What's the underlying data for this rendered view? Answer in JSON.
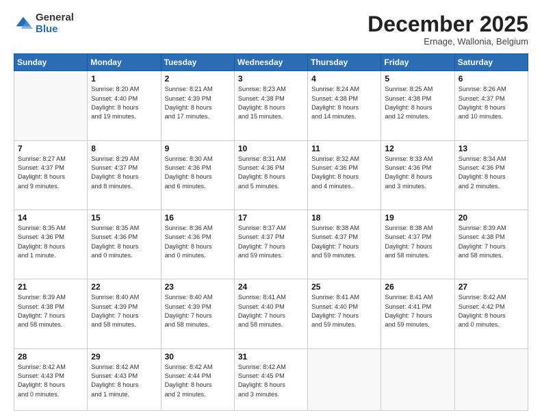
{
  "logo": {
    "general": "General",
    "blue": "Blue"
  },
  "header": {
    "month": "December 2025",
    "location": "Ernage, Wallonia, Belgium"
  },
  "weekdays": [
    "Sunday",
    "Monday",
    "Tuesday",
    "Wednesday",
    "Thursday",
    "Friday",
    "Saturday"
  ],
  "weeks": [
    [
      {
        "day": "",
        "info": ""
      },
      {
        "day": "1",
        "info": "Sunrise: 8:20 AM\nSunset: 4:40 PM\nDaylight: 8 hours\nand 19 minutes."
      },
      {
        "day": "2",
        "info": "Sunrise: 8:21 AM\nSunset: 4:39 PM\nDaylight: 8 hours\nand 17 minutes."
      },
      {
        "day": "3",
        "info": "Sunrise: 8:23 AM\nSunset: 4:38 PM\nDaylight: 8 hours\nand 15 minutes."
      },
      {
        "day": "4",
        "info": "Sunrise: 8:24 AM\nSunset: 4:38 PM\nDaylight: 8 hours\nand 14 minutes."
      },
      {
        "day": "5",
        "info": "Sunrise: 8:25 AM\nSunset: 4:38 PM\nDaylight: 8 hours\nand 12 minutes."
      },
      {
        "day": "6",
        "info": "Sunrise: 8:26 AM\nSunset: 4:37 PM\nDaylight: 8 hours\nand 10 minutes."
      }
    ],
    [
      {
        "day": "7",
        "info": "Sunrise: 8:27 AM\nSunset: 4:37 PM\nDaylight: 8 hours\nand 9 minutes."
      },
      {
        "day": "8",
        "info": "Sunrise: 8:29 AM\nSunset: 4:37 PM\nDaylight: 8 hours\nand 8 minutes."
      },
      {
        "day": "9",
        "info": "Sunrise: 8:30 AM\nSunset: 4:36 PM\nDaylight: 8 hours\nand 6 minutes."
      },
      {
        "day": "10",
        "info": "Sunrise: 8:31 AM\nSunset: 4:36 PM\nDaylight: 8 hours\nand 5 minutes."
      },
      {
        "day": "11",
        "info": "Sunrise: 8:32 AM\nSunset: 4:36 PM\nDaylight: 8 hours\nand 4 minutes."
      },
      {
        "day": "12",
        "info": "Sunrise: 8:33 AM\nSunset: 4:36 PM\nDaylight: 8 hours\nand 3 minutes."
      },
      {
        "day": "13",
        "info": "Sunrise: 8:34 AM\nSunset: 4:36 PM\nDaylight: 8 hours\nand 2 minutes."
      }
    ],
    [
      {
        "day": "14",
        "info": "Sunrise: 8:35 AM\nSunset: 4:36 PM\nDaylight: 8 hours\nand 1 minute."
      },
      {
        "day": "15",
        "info": "Sunrise: 8:35 AM\nSunset: 4:36 PM\nDaylight: 8 hours\nand 0 minutes."
      },
      {
        "day": "16",
        "info": "Sunrise: 8:36 AM\nSunset: 4:36 PM\nDaylight: 8 hours\nand 0 minutes."
      },
      {
        "day": "17",
        "info": "Sunrise: 8:37 AM\nSunset: 4:37 PM\nDaylight: 7 hours\nand 59 minutes."
      },
      {
        "day": "18",
        "info": "Sunrise: 8:38 AM\nSunset: 4:37 PM\nDaylight: 7 hours\nand 59 minutes."
      },
      {
        "day": "19",
        "info": "Sunrise: 8:38 AM\nSunset: 4:37 PM\nDaylight: 7 hours\nand 58 minutes."
      },
      {
        "day": "20",
        "info": "Sunrise: 8:39 AM\nSunset: 4:38 PM\nDaylight: 7 hours\nand 58 minutes."
      }
    ],
    [
      {
        "day": "21",
        "info": "Sunrise: 8:39 AM\nSunset: 4:38 PM\nDaylight: 7 hours\nand 58 minutes."
      },
      {
        "day": "22",
        "info": "Sunrise: 8:40 AM\nSunset: 4:39 PM\nDaylight: 7 hours\nand 58 minutes."
      },
      {
        "day": "23",
        "info": "Sunrise: 8:40 AM\nSunset: 4:39 PM\nDaylight: 7 hours\nand 58 minutes."
      },
      {
        "day": "24",
        "info": "Sunrise: 8:41 AM\nSunset: 4:40 PM\nDaylight: 7 hours\nand 58 minutes."
      },
      {
        "day": "25",
        "info": "Sunrise: 8:41 AM\nSunset: 4:40 PM\nDaylight: 7 hours\nand 59 minutes."
      },
      {
        "day": "26",
        "info": "Sunrise: 8:41 AM\nSunset: 4:41 PM\nDaylight: 7 hours\nand 59 minutes."
      },
      {
        "day": "27",
        "info": "Sunrise: 8:42 AM\nSunset: 4:42 PM\nDaylight: 8 hours\nand 0 minutes."
      }
    ],
    [
      {
        "day": "28",
        "info": "Sunrise: 8:42 AM\nSunset: 4:43 PM\nDaylight: 8 hours\nand 0 minutes."
      },
      {
        "day": "29",
        "info": "Sunrise: 8:42 AM\nSunset: 4:43 PM\nDaylight: 8 hours\nand 1 minute."
      },
      {
        "day": "30",
        "info": "Sunrise: 8:42 AM\nSunset: 4:44 PM\nDaylight: 8 hours\nand 2 minutes."
      },
      {
        "day": "31",
        "info": "Sunrise: 8:42 AM\nSunset: 4:45 PM\nDaylight: 8 hours\nand 3 minutes."
      },
      {
        "day": "",
        "info": ""
      },
      {
        "day": "",
        "info": ""
      },
      {
        "day": "",
        "info": ""
      }
    ]
  ]
}
